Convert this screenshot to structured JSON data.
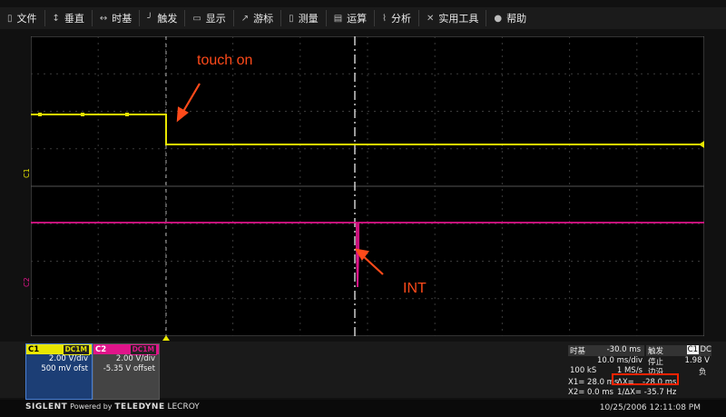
{
  "menu": [
    {
      "icon": "file-icon",
      "glyph": "▯",
      "label": "文件"
    },
    {
      "icon": "vertical-icon",
      "glyph": "↕",
      "label": "垂直"
    },
    {
      "icon": "timebase-icon",
      "glyph": "↔",
      "label": "时基"
    },
    {
      "icon": "trigger-icon",
      "glyph": "╯",
      "label": "触发"
    },
    {
      "icon": "display-icon",
      "glyph": "▭",
      "label": "显示"
    },
    {
      "icon": "cursor-icon",
      "glyph": "↗",
      "label": "游标"
    },
    {
      "icon": "measure-icon",
      "glyph": "▯",
      "label": "测量"
    },
    {
      "icon": "math-icon",
      "glyph": "▤",
      "label": "运算"
    },
    {
      "icon": "analysis-icon",
      "glyph": "⌇",
      "label": "分析"
    },
    {
      "icon": "utilities-icon",
      "glyph": "✕",
      "label": "实用工具"
    },
    {
      "icon": "help-icon",
      "glyph": "●",
      "label": "帮助"
    }
  ],
  "annotations": {
    "touch": "touch on",
    "int": "INT"
  },
  "channel_markers": {
    "c1": "C1",
    "c2": "C2"
  },
  "c1": {
    "name": "C1",
    "tag": "DC1M",
    "vdiv": "2.00 V/div",
    "offset": "500 mV ofst"
  },
  "c2": {
    "name": "C2",
    "tag": "DC1M",
    "vdiv": "2.00 V/div",
    "offset": "-5.35 V offset"
  },
  "timebase": {
    "label": "时基",
    "delay": "-30.0 ms",
    "tdiv": "10.0 ms/div",
    "samples": "100 kS",
    "rate": "1 MS/s"
  },
  "trigger": {
    "label": "触发",
    "src": "C1",
    "coupling": "DC",
    "mode": "停止",
    "level": "1.98 V",
    "edge_label": "边沿",
    "slope": "负"
  },
  "cursors": {
    "x1": "X1= 28.0 ms",
    "dx": "ΔX=",
    "dx_val": "-28.0 ms",
    "x2": "X2= 0.0 ms",
    "inv": "1/ΔX= -35.7 Hz"
  },
  "footer": {
    "brand1": "SIGLENT",
    "brand2": "Powered by",
    "brand3": "TELEDYNE",
    "brand4": "LECROY",
    "datetime": "10/25/2006 12:11:08 PM"
  },
  "colors": {
    "ch1": "#e8e600",
    "ch2": "#e0148a",
    "annotation": "#ff4a1a"
  }
}
